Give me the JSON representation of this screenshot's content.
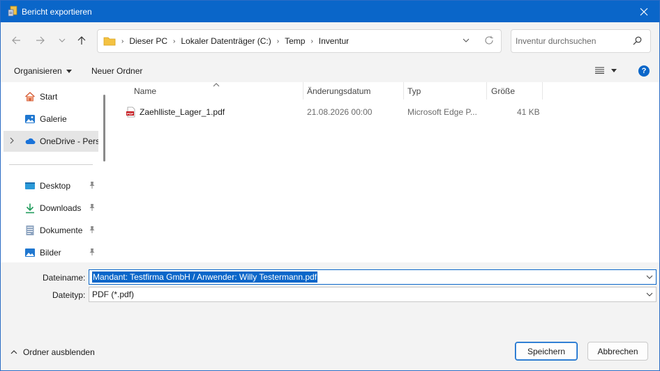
{
  "window": {
    "title": "Bericht exportieren"
  },
  "address": {
    "crumbs": [
      "Dieser PC",
      "Lokaler Datenträger (C:)",
      "Temp",
      "Inventur"
    ]
  },
  "search": {
    "placeholder": "Inventur durchsuchen"
  },
  "toolbar": {
    "organize": "Organisieren",
    "new_folder": "Neuer Ordner"
  },
  "sidebar": {
    "items": [
      {
        "label": "Start",
        "icon": "home-icon"
      },
      {
        "label": "Galerie",
        "icon": "gallery-icon"
      },
      {
        "label": "OneDrive - Perso",
        "icon": "onedrive-icon"
      },
      {
        "label": "Desktop",
        "icon": "desktop-icon",
        "pinned": true
      },
      {
        "label": "Downloads",
        "icon": "download-icon",
        "pinned": true
      },
      {
        "label": "Dokumente",
        "icon": "document-icon",
        "pinned": true
      },
      {
        "label": "Bilder",
        "icon": "pictures-icon",
        "pinned": true
      }
    ]
  },
  "files": {
    "columns": [
      "Name",
      "Änderungsdatum",
      "Typ",
      "Größe"
    ],
    "rows": [
      {
        "name": "Zaehlliste_Lager_1.pdf",
        "modified": "21.08.2026 00:00",
        "type": "Microsoft Edge P...",
        "size": "41 KB"
      }
    ]
  },
  "form": {
    "filename_label": "Dateiname:",
    "filename_value": "Mandant: Testfirma GmbH / Anwender: Willy Testermann.pdf",
    "filetype_label": "Dateityp:",
    "filetype_value": "PDF (*.pdf)"
  },
  "footer": {
    "hide_folders": "Ordner ausblenden",
    "save": "Speichern",
    "cancel": "Abbrechen"
  },
  "colors": {
    "accent": "#0a66c9",
    "title_bar": "#0a66c9",
    "pdf_red": "#c4161c",
    "folder_yellow": "#f4c242"
  }
}
